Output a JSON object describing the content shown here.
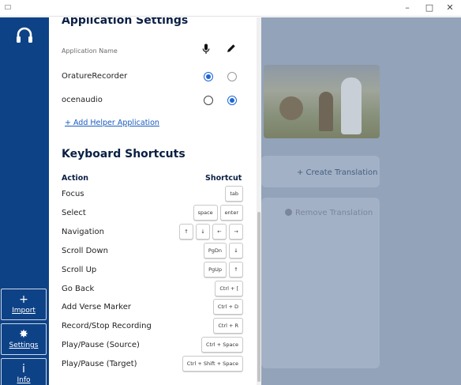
{
  "window": {
    "minimize": "–",
    "maximize": "□",
    "close": "✕"
  },
  "sidebar": {
    "logo_icon": "headphones-icon",
    "items": [
      {
        "label": "Import",
        "icon": "+",
        "icon_name": "plus-icon"
      },
      {
        "label": "Settings",
        "icon": "✸",
        "icon_name": "gear-icon"
      },
      {
        "label": "Info",
        "icon": "i",
        "icon_name": "info-icon"
      }
    ],
    "background": "#0e4287"
  },
  "background_page": {
    "create_translation": "+ Create Translation",
    "remove_translation": "Remove Translation"
  },
  "settings": {
    "app_title": "Application Settings",
    "column_header": "Application Name",
    "column_icons": [
      "microphone-icon",
      "pencil-icon"
    ],
    "applications": [
      {
        "name": "OratureRecorder",
        "record_selected": true,
        "edit_selected": false
      },
      {
        "name": "ocenaudio",
        "record_selected": false,
        "edit_selected": true
      }
    ],
    "add_helper": "+ Add Helper Application",
    "keyboard_title": "Keyboard Shortcuts",
    "keyboard_headers": {
      "action": "Action",
      "shortcut": "Shortcut"
    },
    "shortcuts": [
      {
        "action": "Focus",
        "keys": [
          "tab"
        ]
      },
      {
        "action": "Select",
        "keys": [
          "space",
          "enter"
        ]
      },
      {
        "action": "Navigation",
        "keys": [
          "↑",
          "↓",
          "←",
          "→"
        ]
      },
      {
        "action": "Scroll Down",
        "keys": [
          "PgDn",
          "↓"
        ]
      },
      {
        "action": "Scroll Up",
        "keys": [
          "PgUp",
          "↑"
        ]
      },
      {
        "action": "Go Back",
        "keys": [
          "Ctrl + ["
        ]
      },
      {
        "action": "Add Verse Marker",
        "keys": [
          "Ctrl + D"
        ]
      },
      {
        "action": "Record/Stop Recording",
        "keys": [
          "Ctrl + R"
        ]
      },
      {
        "action": "Play/Pause (Source)",
        "keys": [
          "Ctrl + Space"
        ]
      },
      {
        "action": "Play/Pause (Target)",
        "keys": [
          "Ctrl + Shift + Space"
        ]
      }
    ],
    "accent_color": "#1e66d8"
  }
}
